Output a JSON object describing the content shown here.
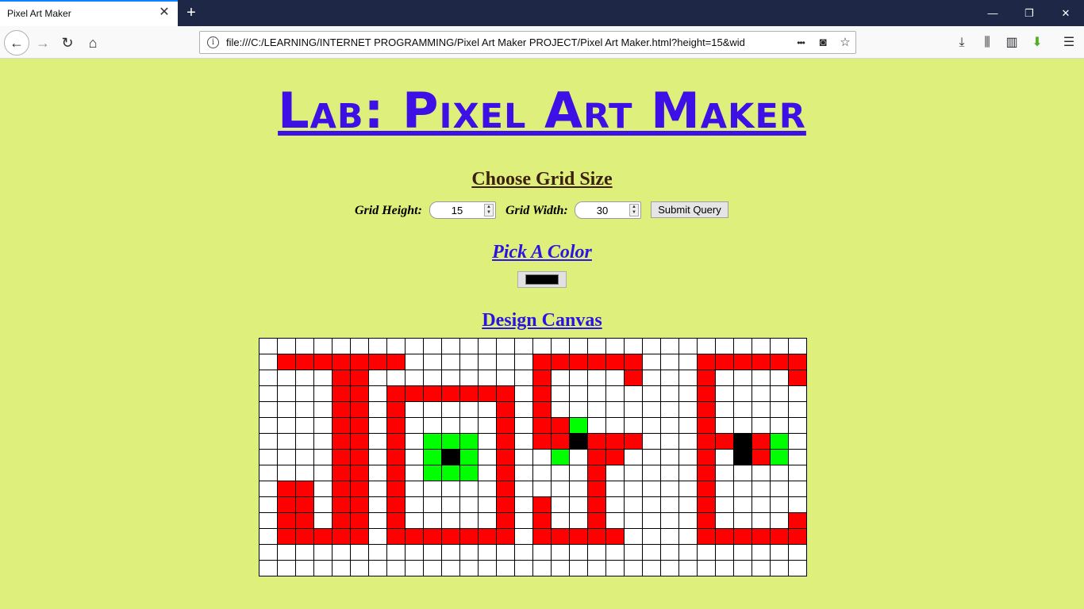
{
  "browser": {
    "tab_title": "Pixel Art Maker",
    "tab_close": "✕",
    "new_tab": "+",
    "window_controls": {
      "minimize": "—",
      "restore": "❐",
      "close": "✕"
    },
    "url": "file:///C:/LEARNING/INTERNET PROGRAMMING/Pixel Art Maker PROJECT/Pixel Art Maker.html?height=15&wid",
    "icons": {
      "back": "←",
      "forward": "→",
      "reload": "↻",
      "home": "⌂",
      "info": "i",
      "more": "•••",
      "pocket": "◙",
      "bookmark": "☆",
      "download": "⤓",
      "library": "⫼",
      "sidebar": "▥",
      "extension": "⬇",
      "menu": "☰"
    }
  },
  "page": {
    "title": "Lab: Pixel Art Maker",
    "grid_size_heading": "Choose Grid Size",
    "height_label": "Grid Height:",
    "height_value": "15",
    "width_label": "Grid Width:",
    "width_value": "30",
    "submit_label": "Submit Query",
    "color_heading": "Pick A Color",
    "selected_color": "#000000",
    "canvas_heading": "Design Canvas"
  },
  "canvas": {
    "rows": 15,
    "cols": 30,
    "palette": {
      ".": "#ffffff",
      "R": "#ff0000",
      "G": "#00ff00",
      "K": "#000000"
    },
    "pattern": [
      "..............................",
      ".RRRRRRR.......RRRRRR...RRRRRR..",
      "....RR.........R....R...R....R..",
      "....RR.RRRRRRR.R........R.......",
      "....RR.R.....R.R........R.......",
      "....RR.R.....R.RRG......R.......",
      "....RR.R.GGG.R.RRKRRR...RRKRG...",
      "....RR.R.GKG.R..G.RR....R.KRG...",
      "....RR.R.GGG.R....R.....R.......",
      ".RR.RR.R.....R....R.....R.......",
      ".RR.RR.R.....R.R..R.....R.......",
      ".RR.RR.R.....R.R..R.....R....R..",
      ".RRRRR.RRRRRRR.RRRRR....RRRRRR..",
      "..............................",
      ".............................."
    ]
  }
}
